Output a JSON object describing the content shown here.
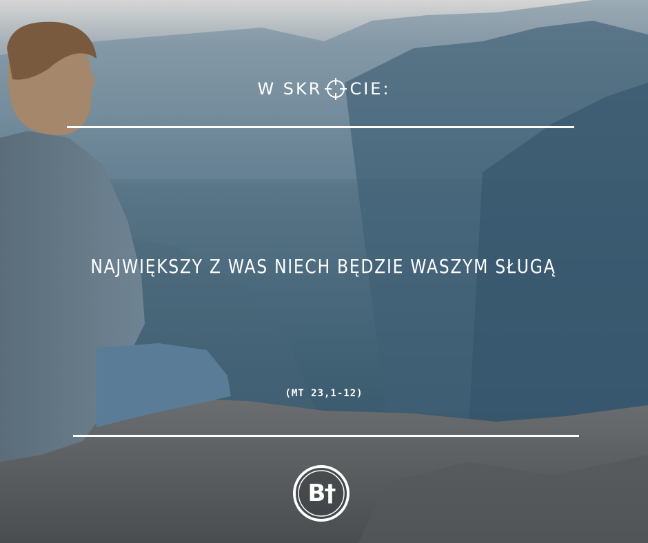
{
  "heading": {
    "part1": "W SKR",
    "part2": "CIE:"
  },
  "quote": {
    "text": "NAJWIĘKSZY Z WAS NIECH BĘDZIE WASZYM SŁUGĄ"
  },
  "reference": {
    "text": "(MT 23,1-12)"
  },
  "logo": {
    "text": "B†"
  },
  "colors": {
    "text": "#ffffff",
    "mist": "#4f6d80",
    "rock": "#5a5e62"
  },
  "icons": [
    "crosshair-icon",
    "logo-badge-icon"
  ]
}
